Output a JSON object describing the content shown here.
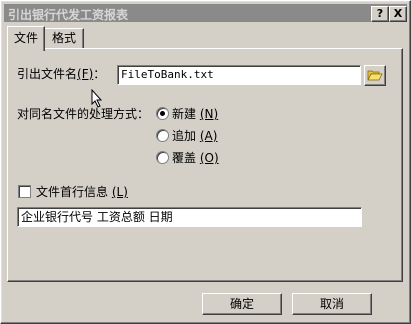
{
  "window": {
    "title": "引出银行代发工资报表",
    "help_label": "?",
    "close_label": "X"
  },
  "tabs": [
    {
      "label": "文件"
    },
    {
      "label": "格式"
    }
  ],
  "file": {
    "name_label": "引出文件名",
    "name_key": "(F)",
    "name_colon": "：",
    "name_value": "FileToBank.txt",
    "browse_icon": "folder-open-icon"
  },
  "same_name": {
    "label": "对同名文件的处理方式：",
    "options": [
      {
        "label": "新建",
        "key": "(N)",
        "selected": true
      },
      {
        "label": "追加",
        "key": "(A)",
        "selected": false
      },
      {
        "label": "覆盖",
        "key": "(O)",
        "selected": false
      }
    ]
  },
  "header_line": {
    "label": "文件首行信息",
    "key": "(L)",
    "checked": false,
    "value": "企业银行代号 工资总额 日期"
  },
  "buttons": {
    "ok": "确定",
    "cancel": "取消"
  }
}
